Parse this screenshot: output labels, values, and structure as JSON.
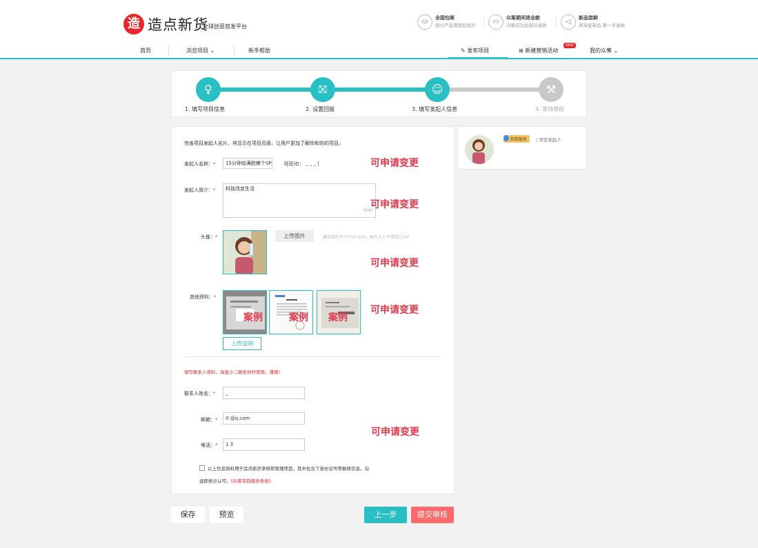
{
  "header": {
    "logo_mark": "造",
    "logo_text": "造点新货",
    "logo_tagline": "全球创意首发平台",
    "features": [
      {
        "icon": "gift-icon",
        "title": "全国包邮",
        "subtitle": "部分产品港澳台除外"
      },
      {
        "icon": "refund-icon",
        "title": "众筹期间退全款",
        "subtitle": "众筹成功后部分退款"
      },
      {
        "icon": "speaker-icon",
        "title": "新品尝鲜",
        "subtitle": "来淘宝新品 第一手尝鲜"
      }
    ],
    "nav": {
      "home": "首页",
      "browse": "浏览项目",
      "help": "新手帮助",
      "publish": "发布项目",
      "campaign": "新建营销活动",
      "campaign_badge": "NEW",
      "my": "我的众筹"
    }
  },
  "steps": [
    {
      "label": "1. 填写项目信息",
      "icon": "lightbulb-icon"
    },
    {
      "label": "2. 设置回报",
      "icon": "gift-icon"
    },
    {
      "label": "3. 填写发起人信息",
      "icon": "person-icon"
    },
    {
      "label": "4. 等待审核",
      "icon": "gavel-icon"
    }
  ],
  "colors": {
    "accent": "#29c0c5",
    "danger": "#e8262b",
    "note": "#e23a4a",
    "inactive": "#c8c8c8"
  },
  "form": {
    "intro": "完善项目发起人名片，将显示在项目页面，让用户更加了解你和你的项目。",
    "sponsor_name_label": "发起人名称：",
    "sponsor_name_value": "15分钟给满脸嫩个SP",
    "wangwang_label": "旺旺ID：",
    "wangwang_value": "_ _ _ |",
    "intro_label": "发起人简介：",
    "intro_value": "科技改变生活",
    "intro_counter": "0/40",
    "avatar_label": "头像：",
    "upload_image_btn": "上传图片",
    "upload_hint": "建议图片尺寸100*100，图片大小不得超过5M",
    "other_label": "其他资料：",
    "example_label": "案例",
    "upload_proof_btn": "上传证明",
    "contact_note": "填写联系人资料，淘宝小二联系你时使用，谨慎！",
    "contact_name_label": "联系人姓名：",
    "contact_name_value": "_",
    "email_label": "邮箱：",
    "email_value": "0              @q.com",
    "phone_label": "电话：",
    "phone_value": "1              3",
    "agree_text_1": "以上信息资料用于造点新货审核和管理项目，其中包含了身份证号等敏感信息。勾",
    "agree_text_2": "选即表示认可。",
    "agree_link": "《众筹项目服务条款》",
    "change_note": "可申请变更"
  },
  "side": {
    "tag": "和我联系",
    "role": "| 项目发起人"
  },
  "buttons": {
    "save": "保存",
    "preview": "预览",
    "prev": "上一步",
    "submit": "提交审核"
  }
}
